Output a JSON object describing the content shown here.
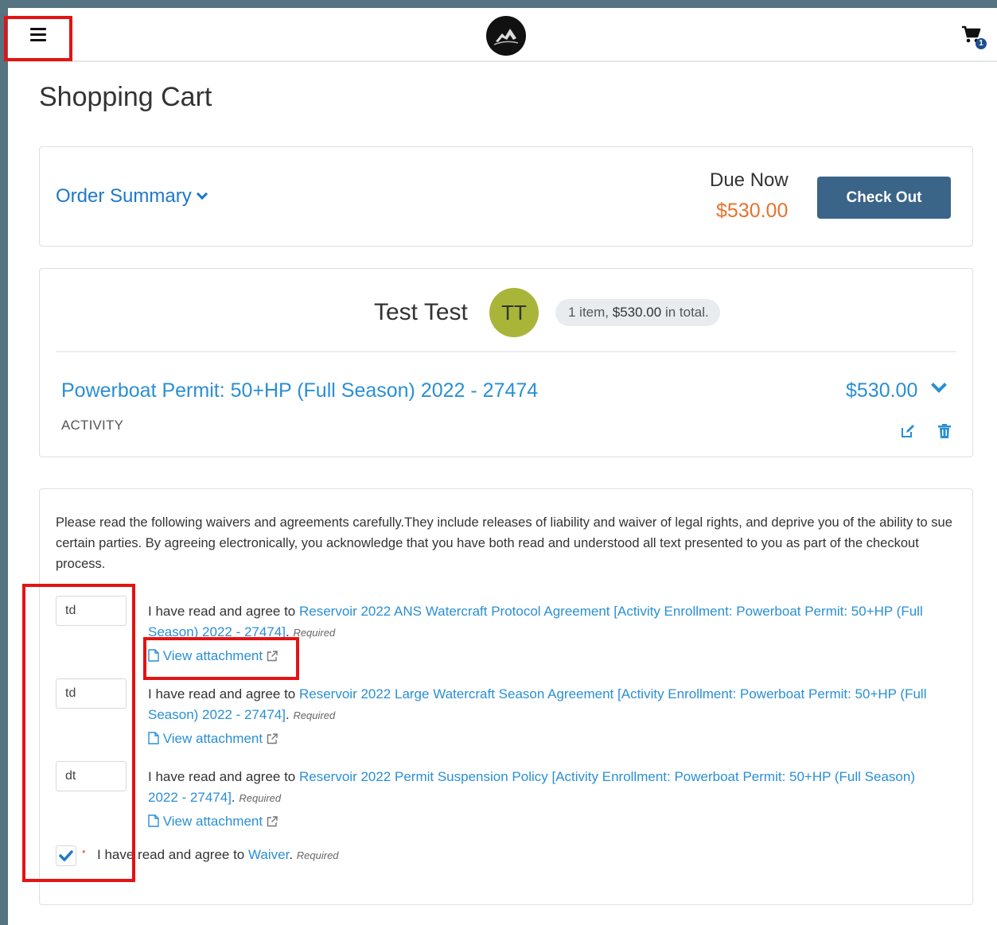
{
  "header": {
    "cart_count": "1"
  },
  "page": {
    "title": "Shopping Cart"
  },
  "summary": {
    "order_summary_label": "Order Summary",
    "due_label": "Due Now",
    "due_amount": "$530.00",
    "checkout_label": "Check Out"
  },
  "customer": {
    "name": "Test Test",
    "initials": "TT",
    "items_count": "1 item,",
    "items_total": "$530.00",
    "items_suffix": "in total."
  },
  "item": {
    "title": "Powerboat Permit: 50+HP (Full Season) 2022 - 27474",
    "type": "ACTIVITY",
    "price": "$530.00"
  },
  "waivers": {
    "intro": "Please read the following waivers and agreements carefully.They include releases of liability and waiver of legal rights, and deprive you of the ability to sue certain parties. By agreeing electronically, you acknowledge that you have both read and understood all text presented to you as part of the checkout process.",
    "agree_prefix": "I have read and agree to",
    "required": "Required",
    "view_attachment": "View attachment",
    "items": [
      {
        "initials": "td",
        "link": "Reservoir 2022 ANS Watercraft Protocol Agreement [Activity Enrollment: Powerboat Permit: 50+HP (Full Season) 2022 - 27474]"
      },
      {
        "initials": "td",
        "link": "Reservoir 2022 Large Watercraft Season Agreement [Activity Enrollment: Powerboat Permit: 50+HP (Full Season) 2022 - 27474]"
      },
      {
        "initials": "dt",
        "link": "Reservoir 2022 Permit Suspension Policy [Activity Enrollment: Powerboat Permit: 50+HP (Full Season) 2022 - 27474]"
      }
    ],
    "checkbox": {
      "checked": true,
      "asterisk": "*",
      "label_prefix": "I have read and agree to",
      "link": "Waiver",
      "required": "Required"
    }
  },
  "colors": {
    "accent": "#2a8fd4",
    "due": "#e8722c",
    "button": "#3a6488",
    "highlight": "#e41313"
  }
}
